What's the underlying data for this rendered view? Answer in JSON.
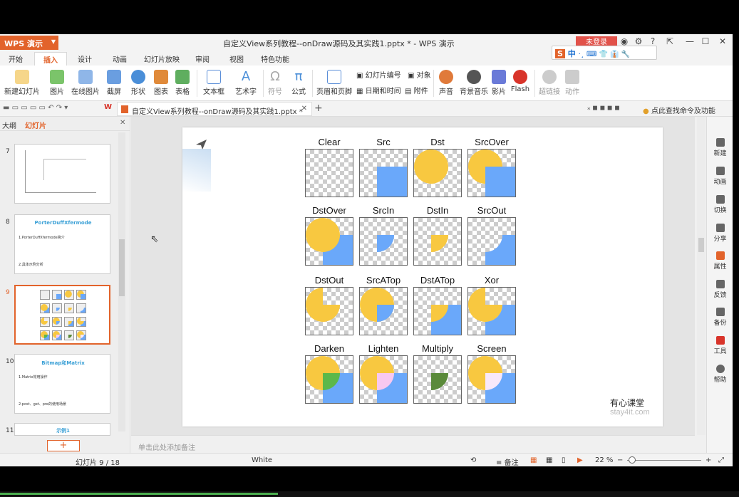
{
  "titlebar": {
    "brand": "WPS 演示",
    "doc_title": "自定义View系列教程--onDraw源码及其实践1.pptx * - WPS 演示",
    "login": "未登录"
  },
  "menu": [
    "开始",
    "插入",
    "设计",
    "动画",
    "幻灯片放映",
    "审阅",
    "视图",
    "特色功能"
  ],
  "ime": {
    "label": "中",
    "extra": "·¸ ⌨ 👕 👔 🔧"
  },
  "ribbon": {
    "new_slide": "新建幻灯片",
    "picture": "图片",
    "online_picture": "在线图片",
    "screenshot": "截屏",
    "shape": "形状",
    "chart": "图表",
    "table": "表格",
    "textbox": "文本框",
    "art_text": "艺术字",
    "symbol": "符号",
    "formula": "公式",
    "header_footer": "页眉和页脚",
    "slide_number": "幻灯片编号",
    "object": "对象",
    "datetime": "日期和时间",
    "attachment": "附件",
    "sound": "声音",
    "bg_music": "背景音乐",
    "video": "影片",
    "flash": "Flash",
    "hyperlink": "超链接",
    "action": "动作"
  },
  "doctab": {
    "title": "自定义View系列教程--onDraw源码及其实践1.pptx *"
  },
  "search_cmd": "点此查找命令及功能",
  "leftpanel": {
    "tab_outline": "大纲",
    "tab_slides": "幻灯片",
    "thumbs": [
      {
        "num": "7",
        "title": "",
        "lines": []
      },
      {
        "num": "8",
        "title": "PorterDuffXfermode",
        "lines": [
          "1.PorterDuffXfermode简介",
          "2.具体示例分析"
        ]
      },
      {
        "num": "9",
        "title": "",
        "lines": []
      },
      {
        "num": "10",
        "title": "Bitmap和Matrix",
        "lines": [
          "1.Matrix常用操作",
          "2.post、get、pre的使用场景"
        ]
      },
      {
        "num": "11",
        "title": "示例1",
        "lines": []
      }
    ]
  },
  "slide": {
    "cells": [
      {
        "label": "Clear"
      },
      {
        "label": "Src"
      },
      {
        "label": "Dst"
      },
      {
        "label": "SrcOver"
      },
      {
        "label": "DstOver"
      },
      {
        "label": "SrcIn"
      },
      {
        "label": "DstIn"
      },
      {
        "label": "SrcOut"
      },
      {
        "label": "DstOut"
      },
      {
        "label": "SrcATop"
      },
      {
        "label": "DstATop"
      },
      {
        "label": "Xor"
      },
      {
        "label": "Darken"
      },
      {
        "label": "Lighten"
      },
      {
        "label": "Multiply"
      },
      {
        "label": "Screen"
      }
    ],
    "watermark_cn": "有心课堂",
    "watermark_en": "stay4it.com",
    "colors": {
      "yellow": "#f8c840",
      "blue": "#6aa8fa",
      "darken": "#5cb84a",
      "lighten": "#f8c8f0",
      "multiply": "#5a8a3a",
      "screen": "#f8e8fa"
    }
  },
  "notes_placeholder": "单击此处添加备注",
  "rightbar": [
    "新建",
    "动画",
    "切换",
    "分享",
    "属性",
    "反馈",
    "备份",
    "工具",
    "帮助"
  ],
  "status": {
    "slide_pos": "幻灯片 9 / 18",
    "theme": "White",
    "notes": "备注",
    "zoom": "22 %"
  }
}
